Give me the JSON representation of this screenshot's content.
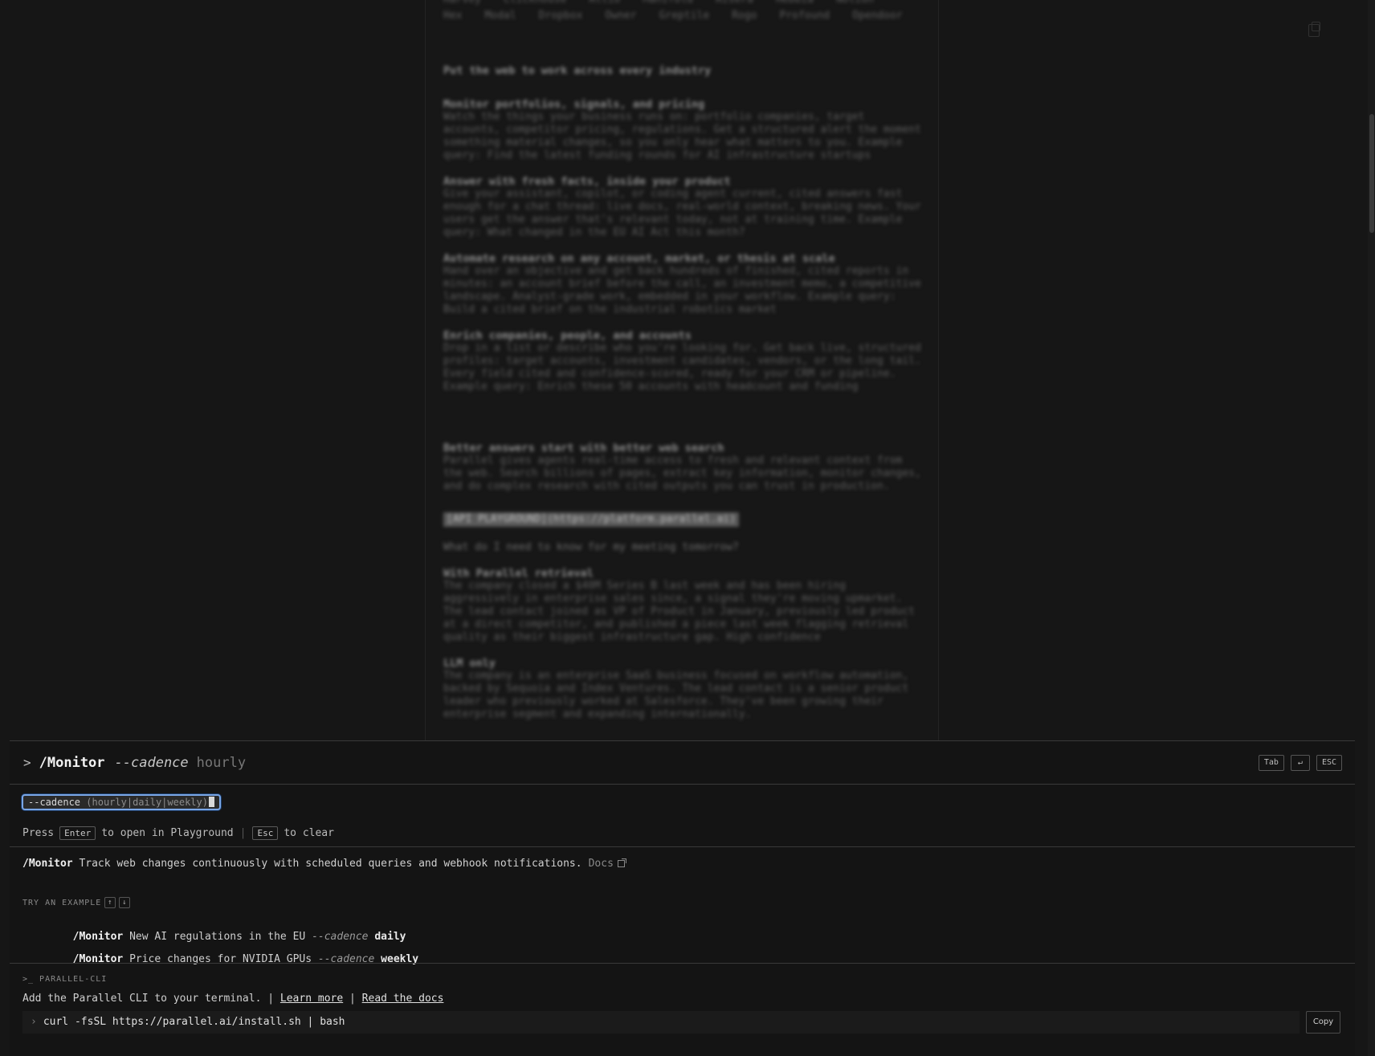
{
  "background": {
    "logos_row1": [
      "Harvey",
      "Clickhouse",
      "Attio",
      "Manifold",
      "Aisera",
      "Hebbia",
      "Notion"
    ],
    "logos_row2": [
      "Hex",
      "Modal",
      "Dropbox",
      "Owner",
      "Greptile",
      "Rogo",
      "Profound",
      "Opendoor"
    ],
    "heading": "Put the web to work across every industry",
    "blocks": [
      {
        "title": "Monitor portfolios, signals, and pricing",
        "body": "Watch the things your business runs on: portfolio companies, target accounts, competitor pricing, regulations. Get a structured alert the moment something material changes, so you only hear what matters to you. Example query: Find the latest funding rounds for AI infrastructure startups"
      },
      {
        "title": "Answer with fresh facts, inside your product",
        "body": "Give your assistant, copilot, or coding agent current, cited answers fast enough for a chat thread: live docs, real-world context, breaking news. Your users get the answer that's relevant today, not at training time. Example query: What changed in the EU AI Act this month?"
      },
      {
        "title": "Automate research on any account, market, or thesis at scale",
        "body": "Hand over an objective and get back hundreds of finished, cited reports in minutes: an account brief before the call, an investment memo, a competitive landscape. Analyst-grade work, embedded in your workflow. Example query: Build a cited brief on the industrial robotics market"
      },
      {
        "title": "Enrich companies, people, and accounts",
        "body": "Drop in a list or describe who you're looking for. Get back live, structured profiles: target accounts, investment candidates, vendors, or the long tail. Every field cited and confidence-scored, ready for your CRM or pipeline. Example query: Enrich these 50 accounts with headcount and funding"
      }
    ],
    "better_title": "Better answers start with better web search",
    "better_body": "Parallel gives agents real-time access to fresh and relevant context from the web. Search billions of pages, extract key information, monitor changes, and do complex research with cited outputs you can trust in production.",
    "playground_pill": "[API PLAYGROUND](https://platform.parallel.ai)",
    "question": "What do I need to know for my meeting tomorrow?",
    "with_title": "With Parallel retrieval",
    "with_body": "The company closed a $40M Series B last week and has been hiring aggressively in enterprise sales since, a signal they're moving upmarket. The lead contact joined as VP of Product in January, previously led product at a direct competitor, and published a piece last week flagging retrieval quality as their biggest infrastructure gap. High confidence",
    "llm_title": "LLM only",
    "llm_body": "The company is an enterprise SaaS business focused on workflow automation, backed by Sequoia and Index Ventures. The lead contact is a senior product leader who previously worked at Salesforce. They've been growing their enterprise segment and expanding internationally."
  },
  "palette": {
    "prompt": ">",
    "command": "/Monitor",
    "flag": "--cadence",
    "value_placeholder": "hourly",
    "keys": [
      "Tab",
      "↵",
      "ESC"
    ],
    "chip_flag": "--cadence",
    "chip_options": "(hourly|daily|weekly)",
    "press_prefix": "Press",
    "press_enter_key": "Enter",
    "press_enter_text": "to open in Playground",
    "press_sep": "|",
    "press_esc_key": "Esc",
    "press_esc_text": "to clear",
    "desc_command": "/Monitor",
    "desc_text": "Track web changes continuously with scheduled queries and webhook notifications.",
    "docs_label": "Docs",
    "try_label": "TRY AN EXAMPLE",
    "examples": [
      {
        "command": "/Monitor",
        "query": "New AI regulations in the EU",
        "flag": "--cadence",
        "value": "daily"
      },
      {
        "command": "/Monitor",
        "query": "Price changes for NVIDIA GPUs",
        "flag": "--cadence",
        "value": "weekly"
      }
    ],
    "cli_label": ">_ PARALLEL-CLI",
    "cli_text": "Add the Parallel CLI to your terminal.",
    "cli_sep": "|",
    "learn_more": "Learn more",
    "read_docs": "Read the docs",
    "install_cmd": "curl -fsSL https://parallel.ai/install.sh | bash",
    "copy_label": "Copy"
  }
}
